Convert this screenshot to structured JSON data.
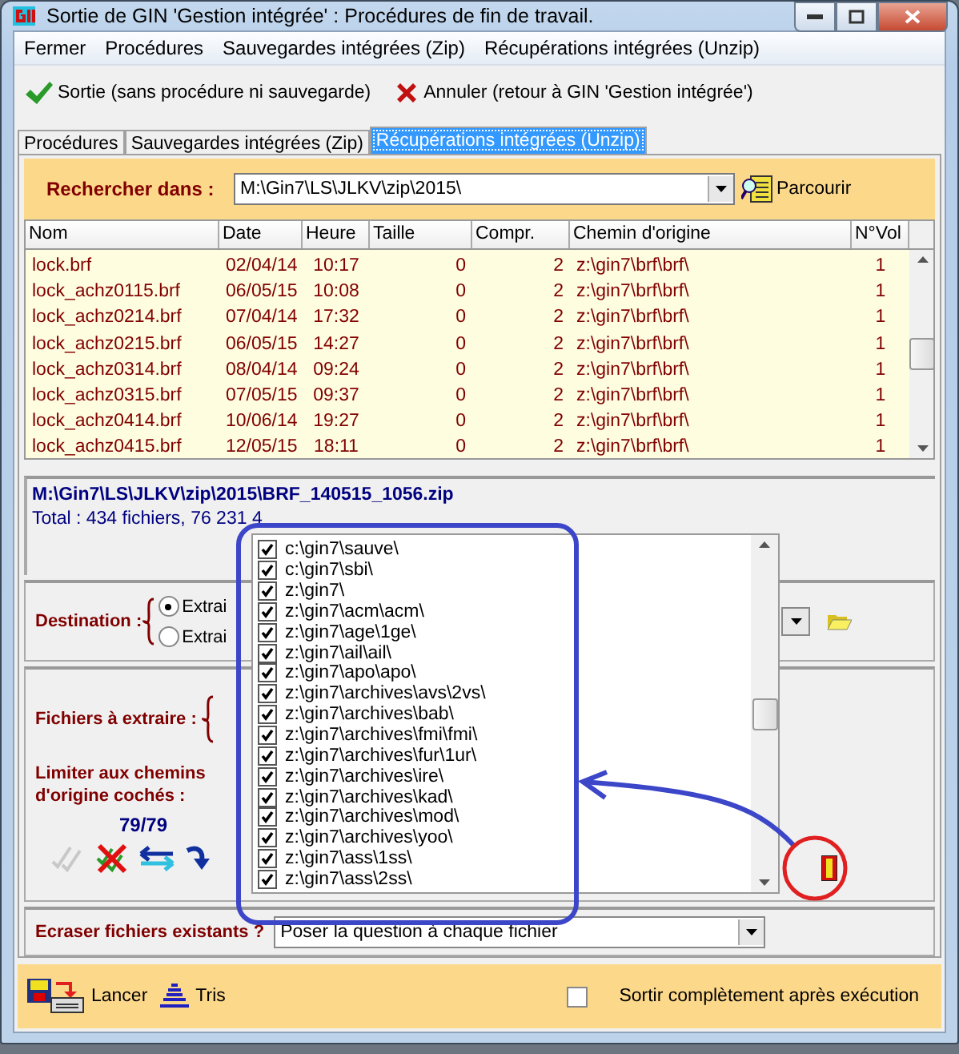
{
  "window": {
    "title": "Sortie de GIN 'Gestion intégrée' : Procédures de fin de travail."
  },
  "menu": [
    "Fermer",
    "Procédures",
    "Sauvegardes intégrées (Zip)",
    "Récupérations intégrées (Unzip)"
  ],
  "toolbar": [
    {
      "kind": "ok",
      "label": "Sortie (sans procédure ni sauvegarde)"
    },
    {
      "kind": "cancel",
      "label": "Annuler (retour à GIN 'Gestion intégrée')"
    }
  ],
  "tabs": [
    {
      "label": "Procédures",
      "selected": false
    },
    {
      "label": "Sauvegardes intégrées (Zip)",
      "selected": false
    },
    {
      "label": "Récupérations intégrées (Unzip)",
      "selected": true
    }
  ],
  "search": {
    "label": "Rechercher dans :",
    "value": "M:\\Gin7\\LS\\JLKV\\zip\\2015\\",
    "browse": "Parcourir"
  },
  "table": {
    "columns": [
      "Nom",
      "Date",
      "Heure",
      "Taille",
      "Compr.",
      "Chemin d'origine",
      "N°Vol"
    ],
    "rows": [
      [
        "lock.brf",
        "02/04/14",
        "10:17",
        "0",
        "2",
        "z:\\gin7\\brf\\brf\\",
        "1"
      ],
      [
        "lock_achz0115.brf",
        "06/05/15",
        "10:08",
        "0",
        "2",
        "z:\\gin7\\brf\\brf\\",
        "1"
      ],
      [
        "lock_achz0214.brf",
        "07/04/14",
        "17:32",
        "0",
        "2",
        "z:\\gin7\\brf\\brf\\",
        "1"
      ],
      [
        "lock_achz0215.brf",
        "06/05/15",
        "14:27",
        "0",
        "2",
        "z:\\gin7\\brf\\brf\\",
        "1"
      ],
      [
        "lock_achz0314.brf",
        "08/04/14",
        "09:24",
        "0",
        "2",
        "z:\\gin7\\brf\\brf\\",
        "1"
      ],
      [
        "lock_achz0315.brf",
        "07/05/15",
        "09:37",
        "0",
        "2",
        "z:\\gin7\\brf\\brf\\",
        "1"
      ],
      [
        "lock_achz0414.brf",
        "10/06/14",
        "19:27",
        "0",
        "2",
        "z:\\gin7\\brf\\brf\\",
        "1"
      ],
      [
        "lock_achz0415.brf",
        "12/05/15",
        "18:11",
        "0",
        "2",
        "z:\\gin7\\brf\\brf\\",
        "1"
      ]
    ]
  },
  "archive": {
    "path": "M:\\Gin7\\LS\\JLKV\\zip\\2015\\BRF_140515_1056.zip",
    "total": "Total : 434 fichiers, 76 231 4"
  },
  "destination": {
    "label": "Destination :",
    "options": [
      {
        "label": "Extrai",
        "selected": true
      },
      {
        "label": "Extrai",
        "selected": false
      }
    ]
  },
  "files": {
    "label": "Fichiers à extraire :",
    "limit_label": "Limiter aux chemins d'origine cochés :",
    "count": "79/79"
  },
  "paths_list": {
    "items": [
      {
        "label": "c:\\gin7\\sauve\\",
        "checked": true
      },
      {
        "label": "c:\\gin7\\sbi\\",
        "checked": true
      },
      {
        "label": "z:\\gin7\\",
        "checked": true
      },
      {
        "label": "z:\\gin7\\acm\\acm\\",
        "checked": true
      },
      {
        "label": "z:\\gin7\\age\\1ge\\",
        "checked": true
      },
      {
        "label": "z:\\gin7\\ail\\ail\\",
        "checked": true
      },
      {
        "label": "z:\\gin7\\apo\\apo\\",
        "checked": true
      },
      {
        "label": "z:\\gin7\\archives\\avs\\2vs\\",
        "checked": true
      },
      {
        "label": "z:\\gin7\\archives\\bab\\",
        "checked": true
      },
      {
        "label": "z:\\gin7\\archives\\fmi\\fmi\\",
        "checked": true
      },
      {
        "label": "z:\\gin7\\archives\\fur\\1ur\\",
        "checked": true
      },
      {
        "label": "z:\\gin7\\archives\\ire\\",
        "checked": true
      },
      {
        "label": "z:\\gin7\\archives\\kad\\",
        "checked": true
      },
      {
        "label": "z:\\gin7\\archives\\mod\\",
        "checked": true
      },
      {
        "label": "z:\\gin7\\archives\\yoo\\",
        "checked": true
      },
      {
        "label": "z:\\gin7\\ass\\1ss\\",
        "checked": true
      },
      {
        "label": "z:\\gin7\\ass\\2ss\\",
        "checked": true
      }
    ]
  },
  "overwrite": {
    "label": "Ecraser fichiers existants ?",
    "value": "Poser la question à chaque fichier"
  },
  "footer": {
    "buttons": [
      {
        "kind": "run",
        "label": "Lancer"
      },
      {
        "kind": "sort",
        "label": "Tris"
      }
    ],
    "exit_option": {
      "label": "Sortir complètement après exécution",
      "checked": false
    }
  }
}
